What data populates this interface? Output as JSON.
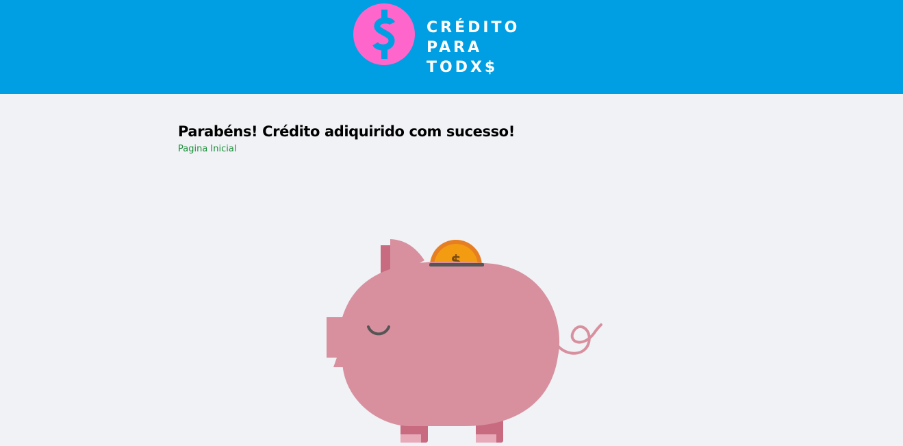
{
  "header": {
    "background_color": "#009fe3",
    "logo": {
      "icon": "dollar-coin-icon",
      "icon_color": "#ff66cc",
      "line1": "CRÉDITO",
      "line2": "PARA TODX$"
    }
  },
  "main": {
    "title": "Parabéns! Crédito adiquirido com sucesso!",
    "home_link": "Pagina Inicial",
    "link_color": "#1b8f3a"
  },
  "illustration": {
    "icon": "piggy-bank-icon",
    "coin_icon": "coin-icon",
    "pig_color": "#d8909f",
    "coin_color": "#f39c12"
  }
}
